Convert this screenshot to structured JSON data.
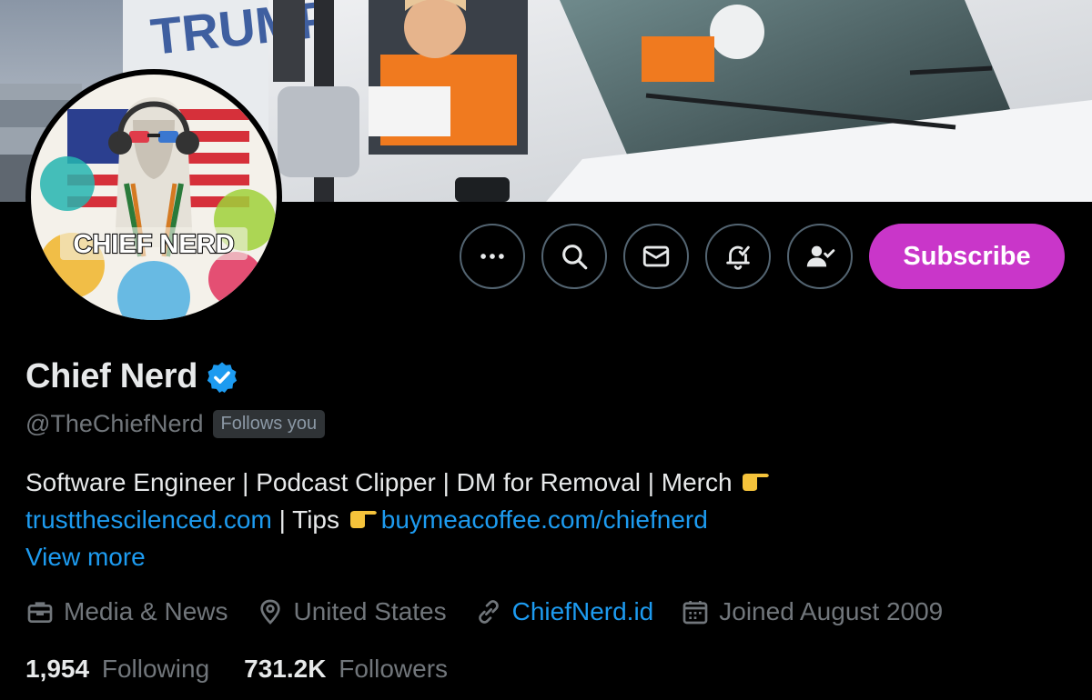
{
  "banner": {
    "truck_text": "TRUMP"
  },
  "avatar": {
    "label": "CHIEF NERD"
  },
  "actions": {
    "more_icon": "ellipsis-icon",
    "search_icon": "search-icon",
    "message_icon": "envelope-icon",
    "notify_icon": "bell-check-icon",
    "follow_icon": "person-check-icon",
    "subscribe_label": "Subscribe",
    "subscribe_color": "#c936c9"
  },
  "profile": {
    "name": "Chief Nerd",
    "verified_icon": "verified-badge-icon",
    "verified_color": "#1d9bf0",
    "handle": "@TheChiefNerd",
    "follows_you": "Follows you",
    "bio_line1": "Software Engineer | Podcast Clipper |  DM for Removal | Merch",
    "bio_link1": "trustthescilenced.com",
    "bio_sep": " | Tips",
    "bio_link2": "buymeacoffee.com/chiefnerd",
    "view_more": "View more"
  },
  "meta": {
    "category": "Media & News",
    "location": "United States",
    "website": "ChiefNerd.id",
    "joined": "Joined August 2009"
  },
  "stats": {
    "following_count": "1,954",
    "following_label": "Following",
    "followers_count": "731.2K",
    "followers_label": "Followers"
  }
}
